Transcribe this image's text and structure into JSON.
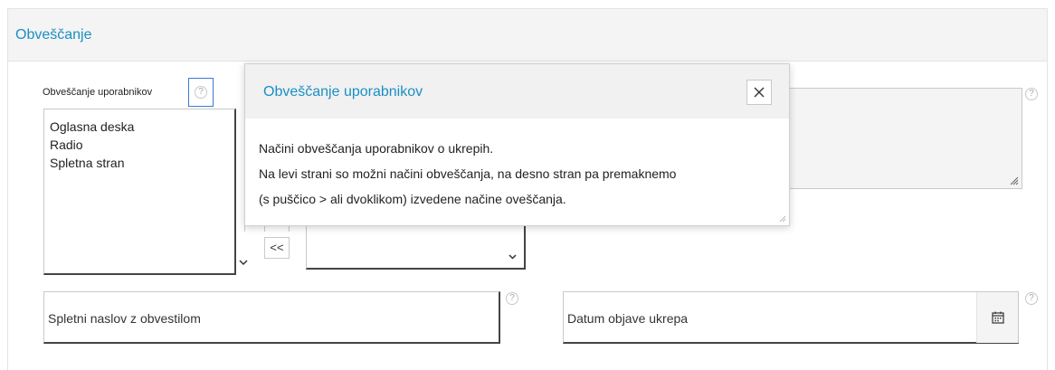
{
  "panel": {
    "title": "Obveščanje"
  },
  "notifications_field": {
    "label": "Obveščanje uporabnikov",
    "help_glyph": "?",
    "available_options": [
      "Oglasna deska",
      "Radio",
      "Spletna stran"
    ],
    "move_left_label": "<<"
  },
  "url_field": {
    "placeholder": "Spletni naslov z obvestilom",
    "help_glyph": "?"
  },
  "date_field": {
    "placeholder": "Datum objave ukrepa",
    "help_glyph": "?",
    "icon": "calendar-icon"
  },
  "textarea_help_glyph": "?",
  "popup": {
    "title": "Obveščanje uporabnikov",
    "close_icon": "close-icon",
    "lines": [
      "Načini obveščanja uporabnikov o ukrepih.",
      "Na levi strani so možni načini obveščanja, na desno stran pa premaknemo",
      "(s puščico > ali dvoklikom) izvedene načine oveščanja."
    ]
  },
  "colors": {
    "accent": "#1a8fc4",
    "header_bg": "#f4f4f4",
    "focus_border": "#3a7bd5"
  }
}
